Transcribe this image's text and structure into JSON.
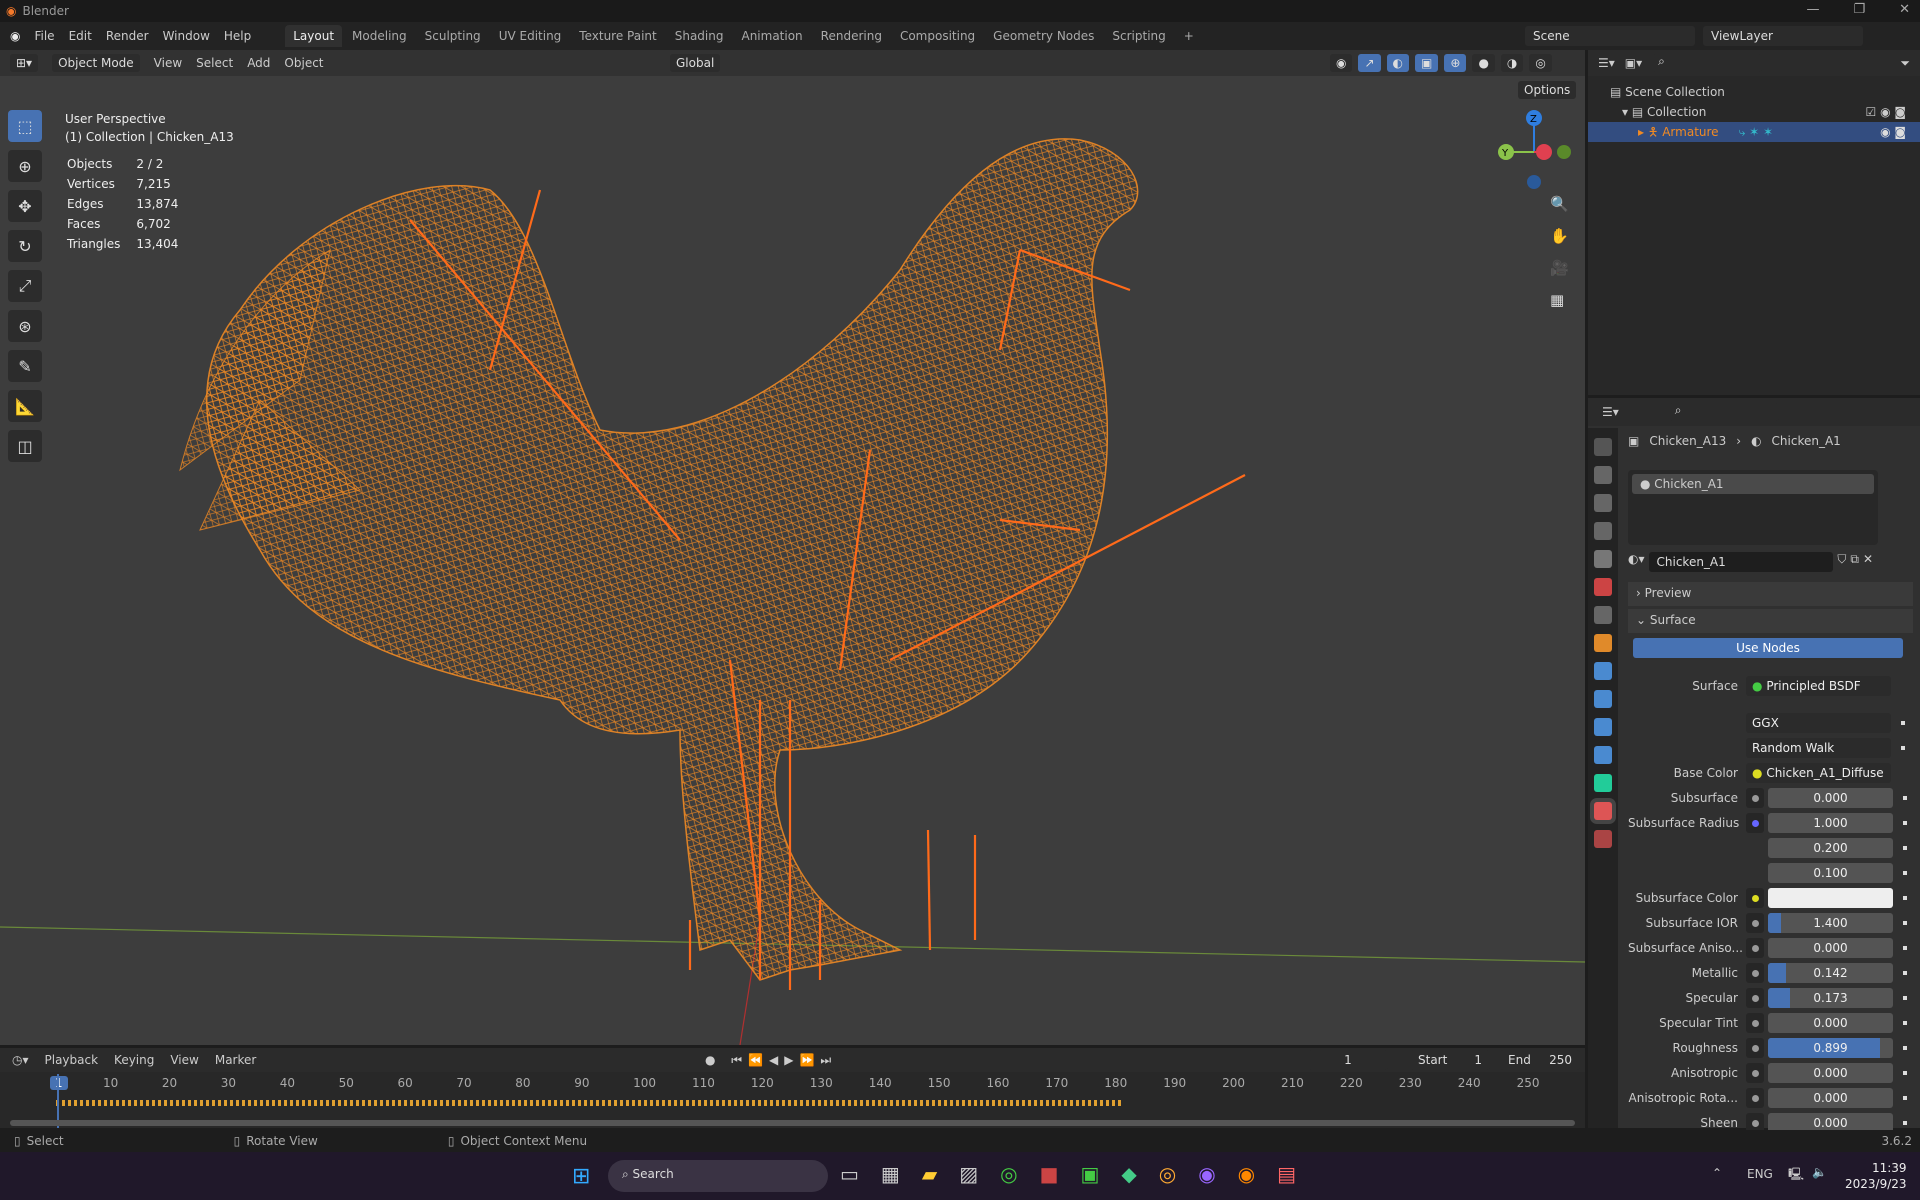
{
  "app_title": "Blender",
  "menu": [
    "File",
    "Edit",
    "Render",
    "Window",
    "Help"
  ],
  "workspaces": [
    "Layout",
    "Modeling",
    "Sculpting",
    "UV Editing",
    "Texture Paint",
    "Shading",
    "Animation",
    "Rendering",
    "Compositing",
    "Geometry Nodes",
    "Scripting",
    "+"
  ],
  "scene": "Scene",
  "view_layer": "ViewLayer",
  "viewport": {
    "mode": "Object Mode",
    "menus": [
      "View",
      "Select",
      "Add",
      "Object"
    ],
    "orientation": "Global",
    "options": "Options",
    "perspective": "User Perspective",
    "collection_info": "(1) Collection | Chicken_A13",
    "stats": [
      [
        "Objects",
        "2 / 2"
      ],
      [
        "Vertices",
        "7,215"
      ],
      [
        "Edges",
        "13,874"
      ],
      [
        "Faces",
        "6,702"
      ],
      [
        "Triangles",
        "13,404"
      ]
    ],
    "gizmo": {
      "x": "X",
      "y": "Y",
      "z": "Z"
    }
  },
  "outliner": {
    "scene_collection": "Scene Collection",
    "collection": "Collection",
    "armature": "Armature"
  },
  "properties": {
    "object": "Chicken_A13",
    "material": "Chicken_A1",
    "slot": "Chicken_A1",
    "material_field": "Chicken_A1",
    "preview": "Preview",
    "surface_panel": "Surface",
    "use_nodes": "Use Nodes",
    "surface_label": "Surface",
    "surface_value": "Principled BSDF",
    "distribution": "GGX",
    "subsurface_method": "Random Walk",
    "base_color_label": "Base Color",
    "base_color_value": "Chicken_A1_Diffuse",
    "rows": [
      {
        "label": "Subsurface",
        "value": "0.000",
        "fill": 0
      },
      {
        "label": "Subsurface Radius",
        "value": "1.000",
        "fill": 0
      },
      {
        "label": "",
        "value": "0.200",
        "fill": 0
      },
      {
        "label": "",
        "value": "0.100",
        "fill": 0
      },
      {
        "label": "Subsurface Color",
        "value": "",
        "fill": 0
      },
      {
        "label": "Subsurface IOR",
        "value": "1.400",
        "fill": 0.1
      },
      {
        "label": "Subsurface Aniso...",
        "value": "0.000",
        "fill": 0
      },
      {
        "label": "Metallic",
        "value": "0.142",
        "fill": 0.142
      },
      {
        "label": "Specular",
        "value": "0.173",
        "fill": 0.173
      },
      {
        "label": "Specular Tint",
        "value": "0.000",
        "fill": 0
      },
      {
        "label": "Roughness",
        "value": "0.899",
        "fill": 0.899
      },
      {
        "label": "Anisotropic",
        "value": "0.000",
        "fill": 0
      },
      {
        "label": "Anisotropic Rota...",
        "value": "0.000",
        "fill": 0
      },
      {
        "label": "Sheen",
        "value": "0.000",
        "fill": 0
      }
    ]
  },
  "timeline": {
    "menus": [
      "Playback",
      "Keying",
      "View",
      "Marker"
    ],
    "current": "1",
    "start_label": "Start",
    "start": "1",
    "end_label": "End",
    "end": "250",
    "ticks": [
      "1",
      "10",
      "20",
      "30",
      "40",
      "50",
      "60",
      "70",
      "80",
      "90",
      "100",
      "110",
      "120",
      "130",
      "140",
      "150",
      "160",
      "170",
      "180",
      "190",
      "200",
      "210",
      "220",
      "230",
      "240",
      "250"
    ]
  },
  "status": {
    "select": "Select",
    "rotate": "Rotate View",
    "context": "Object Context Menu",
    "version": "3.6.2"
  },
  "taskbar": {
    "search": "Search",
    "lang": "ENG",
    "time": "11:39",
    "date": "2023/9/23"
  },
  "colors": {
    "accent": "#4772b3",
    "wire": "#f08a24",
    "bone": "#ff6a1a"
  }
}
